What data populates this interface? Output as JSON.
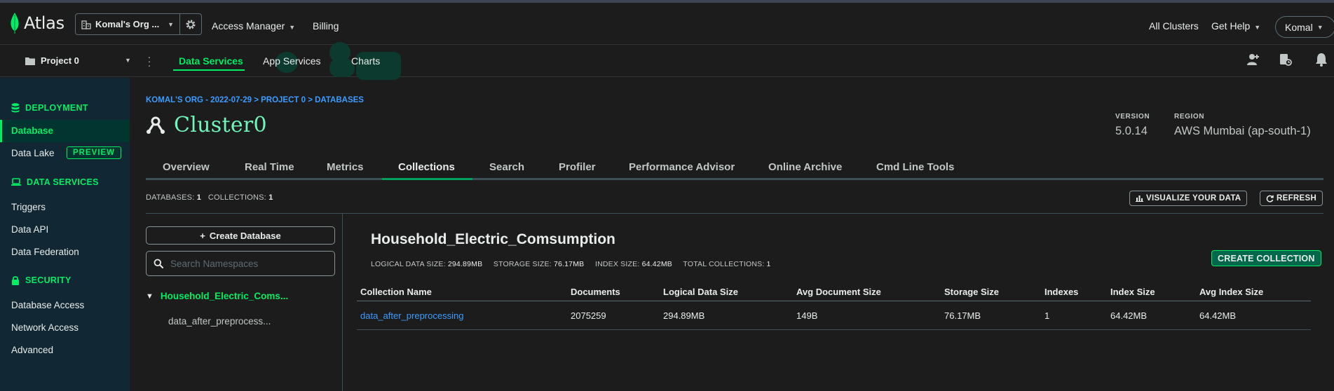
{
  "topbar": {
    "logo_text": "Atlas",
    "org_name": "Komal's Org ...",
    "access_manager": "Access Manager",
    "billing": "Billing",
    "all_clusters": "All Clusters",
    "get_help": "Get Help",
    "user": "Komal"
  },
  "subbar": {
    "project": "Project 0",
    "tabs": [
      "Data Services",
      "App Services",
      "Charts"
    ],
    "active_tab": "Data Services"
  },
  "sidebar": {
    "deployment_header": "DEPLOYMENT",
    "database": "Database",
    "data_lake": "Data Lake",
    "preview_badge": "PREVIEW",
    "data_services_header": "DATA SERVICES",
    "triggers": "Triggers",
    "data_api": "Data API",
    "data_federation": "Data Federation",
    "security_header": "SECURITY",
    "database_access": "Database Access",
    "network_access": "Network Access",
    "advanced": "Advanced"
  },
  "main": {
    "breadcrumb": "KOMAL'S ORG - 2022-07-29 > PROJECT 0 > DATABASES",
    "cluster_name": "Cluster0",
    "version_label": "VERSION",
    "version_value": "5.0.14",
    "region_label": "REGION",
    "region_value": "AWS Mumbai (ap-south-1)",
    "tabs": [
      "Overview",
      "Real Time",
      "Metrics",
      "Collections",
      "Search",
      "Profiler",
      "Performance Advisor",
      "Online Archive",
      "Cmd Line Tools"
    ],
    "active_tab": "Collections",
    "databases_label": "DATABASES:",
    "databases_count": "1",
    "collections_label": "COLLECTIONS:",
    "collections_count": "1",
    "visualize_button": "VISUALIZE YOUR DATA",
    "refresh_button": "REFRESH",
    "create_database_button": "Create Database",
    "search_placeholder": "Search Namespaces",
    "tree_database": "Household_Electric_Coms...",
    "tree_collection": "data_after_preprocess..."
  },
  "detail": {
    "db_name": "Household_Electric_Comsumption",
    "logical_size_label": "LOGICAL DATA SIZE:",
    "logical_size_value": "294.89MB",
    "storage_size_label": "STORAGE SIZE:",
    "storage_size_value": "76.17MB",
    "index_size_label": "INDEX SIZE:",
    "index_size_value": "64.42MB",
    "total_collections_label": "TOTAL COLLECTIONS:",
    "total_collections_value": "1",
    "create_collection_button": "CREATE COLLECTION",
    "table": {
      "headers": [
        "Collection Name",
        "Documents",
        "Logical Data Size",
        "Avg Document Size",
        "Storage Size",
        "Indexes",
        "Index Size",
        "Avg Index Size"
      ],
      "rows": [
        [
          "data_after_preprocessing",
          "2075259",
          "294.89MB",
          "149B",
          "76.17MB",
          "1",
          "64.42MB",
          "64.42MB"
        ]
      ]
    }
  },
  "colors": {
    "accent_green": "#00ed64",
    "link_blue": "#3d9cff",
    "sidebar_bg": "#112733",
    "page_bg": "#1c1c1c"
  }
}
